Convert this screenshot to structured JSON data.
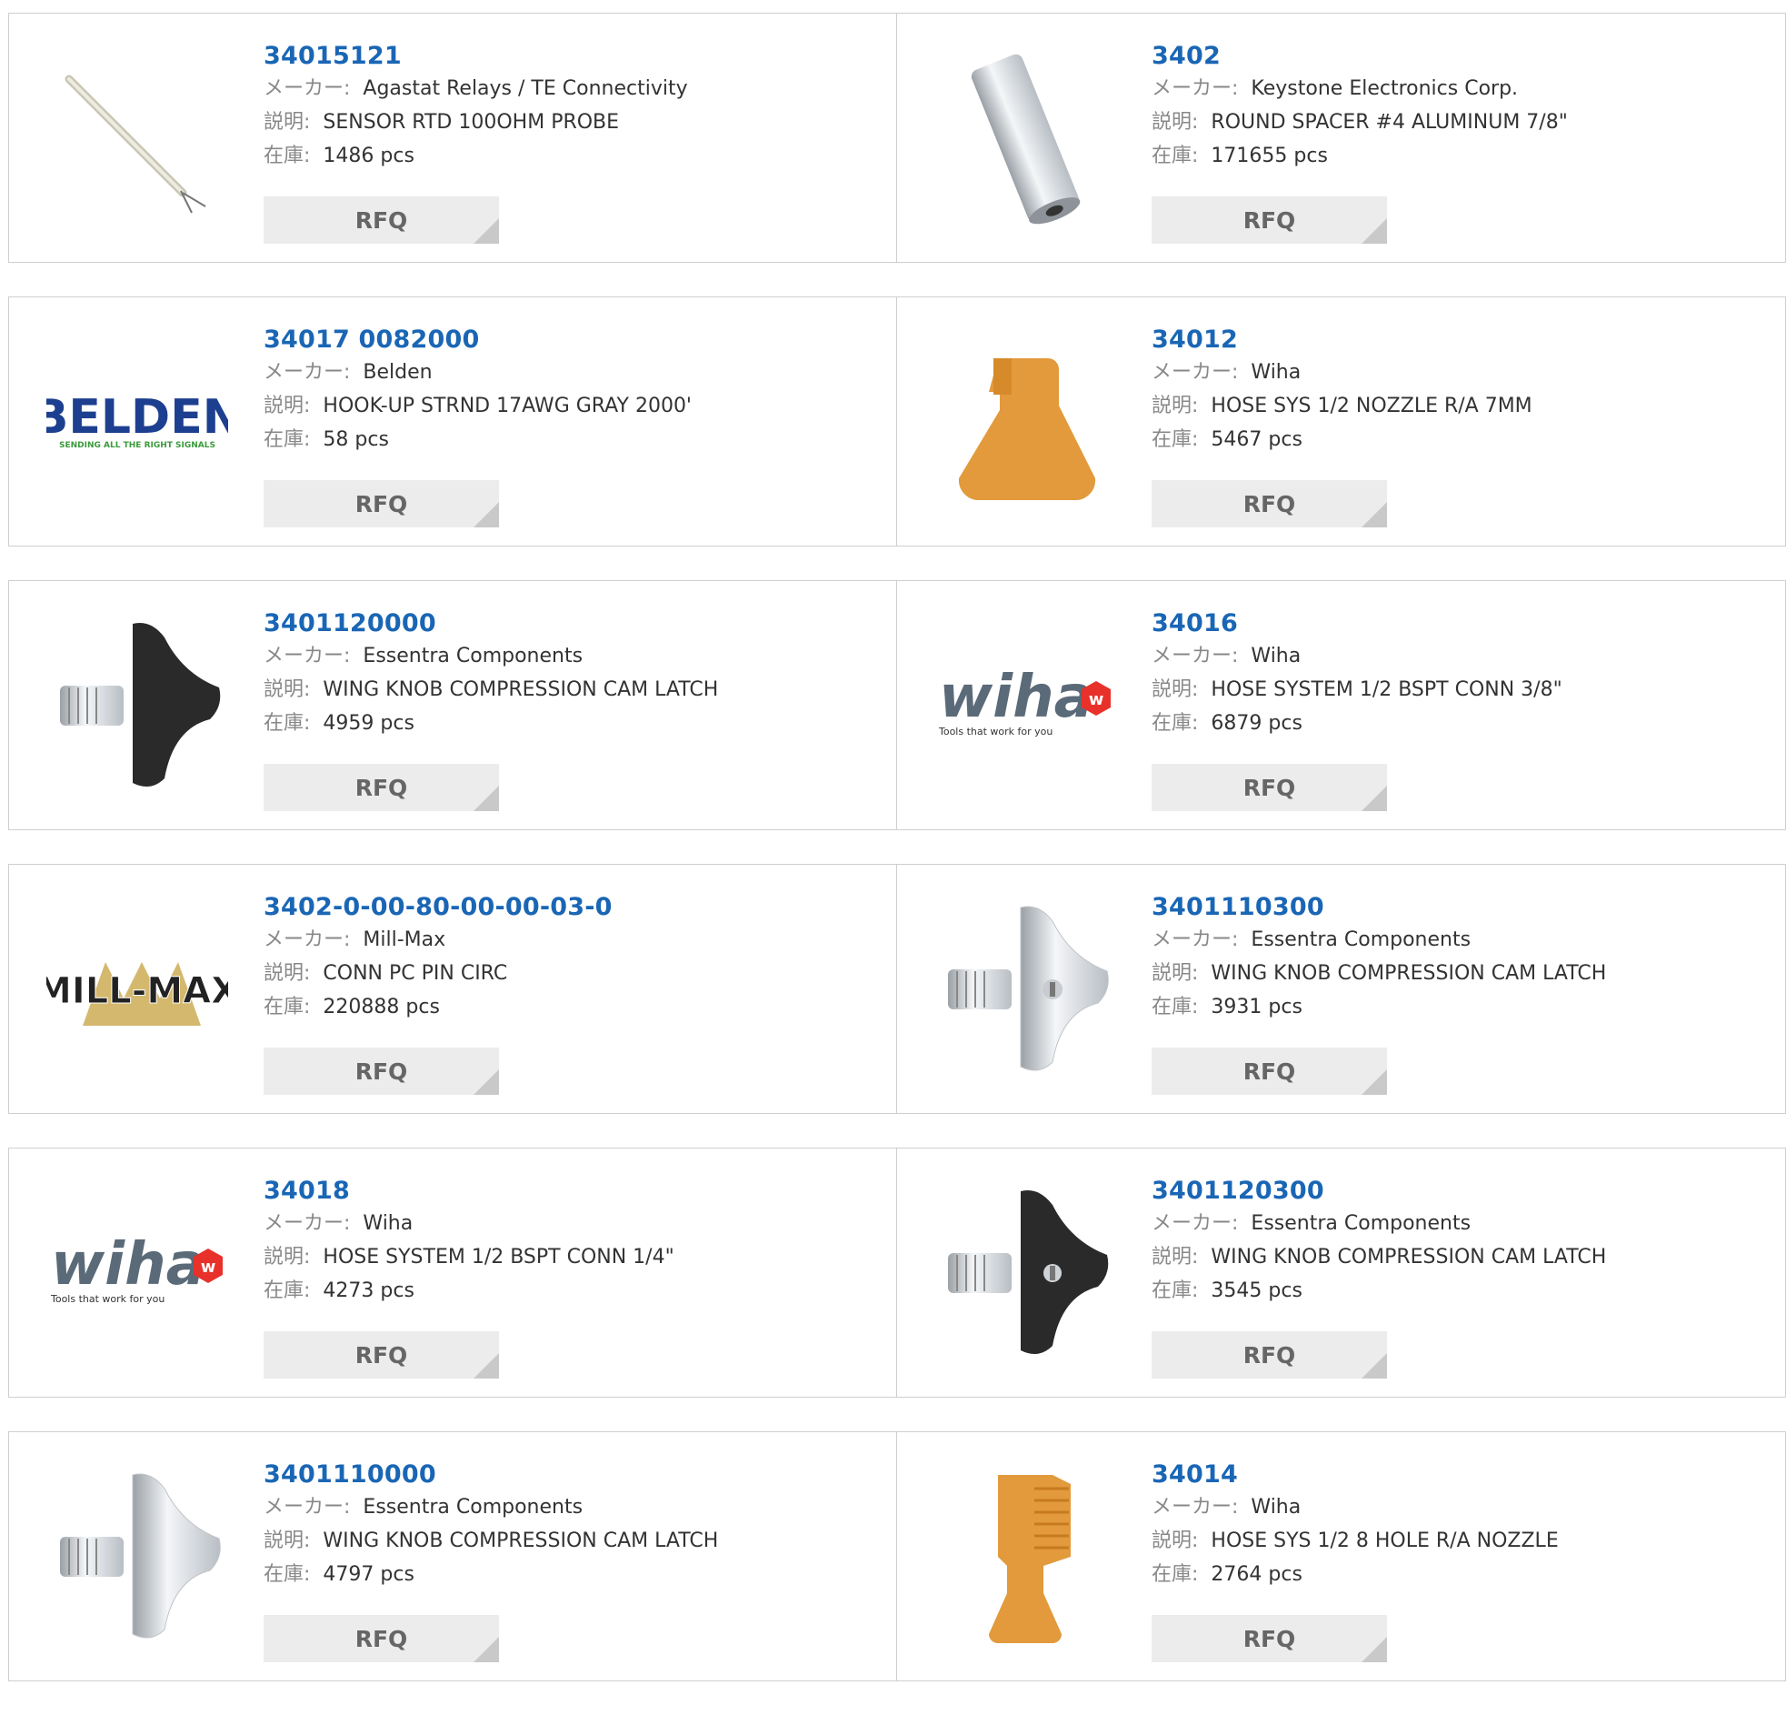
{
  "labels": {
    "maker": "メーカー:",
    "desc": "説明:",
    "stock": "在庫:"
  },
  "rfq_label": "RFQ",
  "products": [
    {
      "pn": "34015121",
      "maker": "Agastat Relays / TE Connectivity",
      "desc": "SENSOR RTD 100OHM PROBE",
      "stock": "1486 pcs",
      "image": "probe"
    },
    {
      "pn": "3402",
      "maker": "Keystone Electronics Corp.",
      "desc": "ROUND SPACER #4 ALUMINUM 7/8\"",
      "stock": "171655 pcs",
      "image": "spacer"
    },
    {
      "pn": "34017 0082000",
      "maker": "Belden",
      "desc": "HOOK-UP STRND 17AWG GRAY 2000'",
      "stock": "58 pcs",
      "image": "belden-logo"
    },
    {
      "pn": "34012",
      "maker": "Wiha",
      "desc": "HOSE SYS 1/2 NOZZLE R/A 7MM",
      "stock": "5467 pcs",
      "image": "orange-nozzle"
    },
    {
      "pn": "3401120000",
      "maker": "Essentra Components",
      "desc": "WING KNOB COMPRESSION CAM LATCH",
      "stock": "4959 pcs",
      "image": "black-latch"
    },
    {
      "pn": "34016",
      "maker": "Wiha",
      "desc": "HOSE SYSTEM 1/2 BSPT CONN 3/8\"",
      "stock": "6879 pcs",
      "image": "wiha-logo"
    },
    {
      "pn": "3402-0-00-80-00-00-03-0",
      "maker": "Mill-Max",
      "desc": "CONN PC PIN CIRC",
      "stock": "220888 pcs",
      "image": "millmax-logo"
    },
    {
      "pn": "3401110300",
      "maker": "Essentra Components",
      "desc": "WING KNOB COMPRESSION CAM LATCH",
      "stock": "3931 pcs",
      "image": "chrome-latch-key"
    },
    {
      "pn": "34018",
      "maker": "Wiha",
      "desc": "HOSE SYSTEM 1/2 BSPT CONN 1/4\"",
      "stock": "4273 pcs",
      "image": "wiha-logo"
    },
    {
      "pn": "3401120300",
      "maker": "Essentra Components",
      "desc": "WING KNOB COMPRESSION CAM LATCH",
      "stock": "3545 pcs",
      "image": "black-latch-key"
    },
    {
      "pn": "3401110000",
      "maker": "Essentra Components",
      "desc": "WING KNOB COMPRESSION CAM LATCH",
      "stock": "4797 pcs",
      "image": "chrome-latch"
    },
    {
      "pn": "34014",
      "maker": "Wiha",
      "desc": "HOSE SYS 1/2 8 HOLE R/A NOZZLE",
      "stock": "2764 pcs",
      "image": "orange-nozzle-8hole"
    }
  ],
  "logos": {
    "belden": {
      "name": "BELDEN",
      "tagline": "SENDING ALL THE RIGHT SIGNALS"
    },
    "wiha": {
      "name": "wiha",
      "tagline": "Tools that work for you"
    },
    "millmax": {
      "name": "MILL-MAX"
    }
  },
  "colors": {
    "link": "#1a66b5",
    "button_bg": "#ececec",
    "button_corner": "#c9c9c9",
    "border": "#cfcfcf",
    "belden_blue": "#1d3f8f",
    "belden_green": "#3a9a3a",
    "wiha_grey": "#5a6a78",
    "wiha_red": "#e8312a",
    "orange": "#e29a3c",
    "black_knob": "#2a2a2a",
    "chrome": "#d9dde2"
  }
}
